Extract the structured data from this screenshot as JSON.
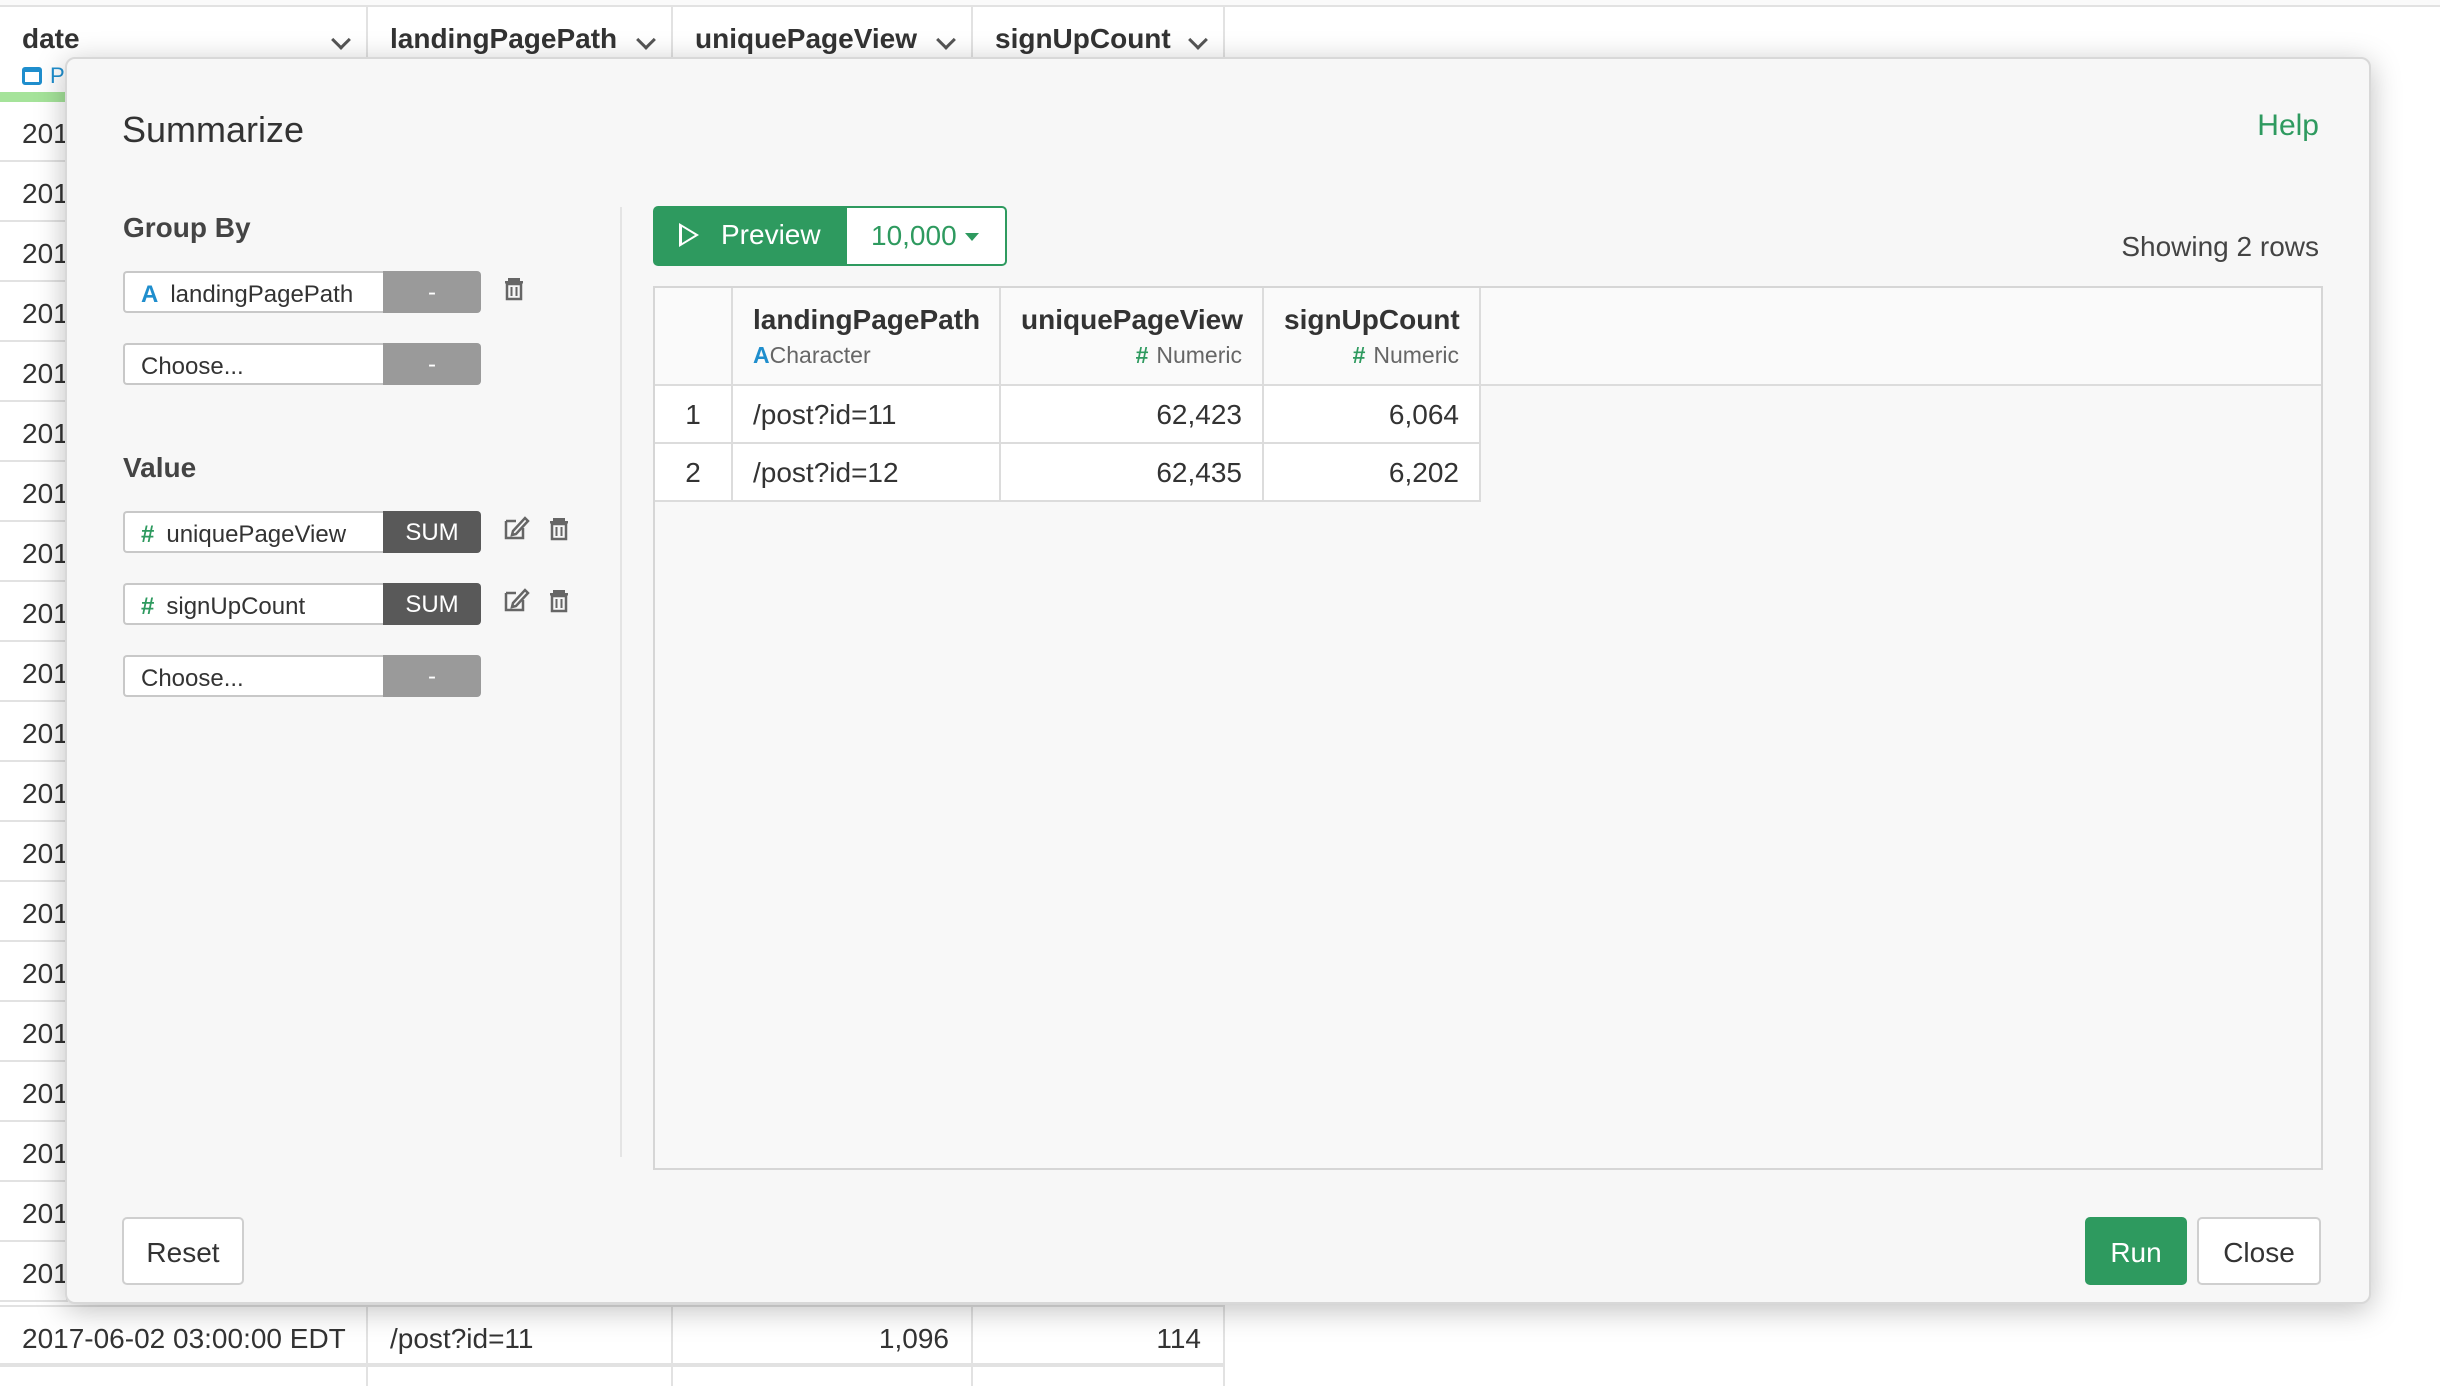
{
  "background_grid": {
    "columns": [
      {
        "name": "date",
        "sub": "P"
      },
      {
        "name": "landingPagePath"
      },
      {
        "name": "uniquePageView"
      },
      {
        "name": "signUpCount"
      }
    ],
    "row_stubs": [
      "201",
      "201",
      "201",
      "201",
      "201",
      "201",
      "201",
      "201",
      "201",
      "201",
      "201",
      "201",
      "201",
      "201",
      "201",
      "201",
      "201",
      "201",
      "201",
      "201"
    ],
    "visible_row": {
      "date": "2017-06-02 03:00:00 EDT",
      "landingPagePath": "/post?id=11",
      "uniquePageView": "1,096",
      "signUpCount": "114"
    }
  },
  "modal": {
    "title": "Summarize",
    "help_label": "Help",
    "group_by": {
      "label": "Group By",
      "fields": [
        {
          "type_icon": "A",
          "name": "landingPagePath",
          "fn": "-"
        },
        {
          "type_icon": "",
          "name": "Choose...",
          "fn": "-"
        }
      ]
    },
    "value": {
      "label": "Value",
      "fields": [
        {
          "type_icon": "#",
          "name": "uniquePageView",
          "fn": "SUM"
        },
        {
          "type_icon": "#",
          "name": "signUpCount",
          "fn": "SUM"
        },
        {
          "type_icon": "",
          "name": "Choose...",
          "fn": "-"
        }
      ]
    },
    "preview": {
      "label": "Preview",
      "rows_option": "10,000",
      "showing_text": "Showing 2 rows"
    },
    "result_table": {
      "columns": [
        {
          "name": "landingPagePath",
          "type_icon": "A",
          "type": "Character"
        },
        {
          "name": "uniquePageView",
          "type_icon": "#",
          "type": "Numeric"
        },
        {
          "name": "signUpCount",
          "type_icon": "#",
          "type": "Numeric"
        }
      ],
      "rows": [
        {
          "index": "1",
          "landingPagePath": "/post?id=11",
          "uniquePageView": "62,423",
          "signUpCount": "6,064"
        },
        {
          "index": "2",
          "landingPagePath": "/post?id=12",
          "uniquePageView": "62,435",
          "signUpCount": "6,202"
        }
      ]
    },
    "buttons": {
      "reset": "Reset",
      "run": "Run",
      "close": "Close"
    }
  },
  "colors": {
    "accent_green": "#2e9a5f",
    "character_blue": "#1f8ecd",
    "sum_dark": "#595959"
  }
}
